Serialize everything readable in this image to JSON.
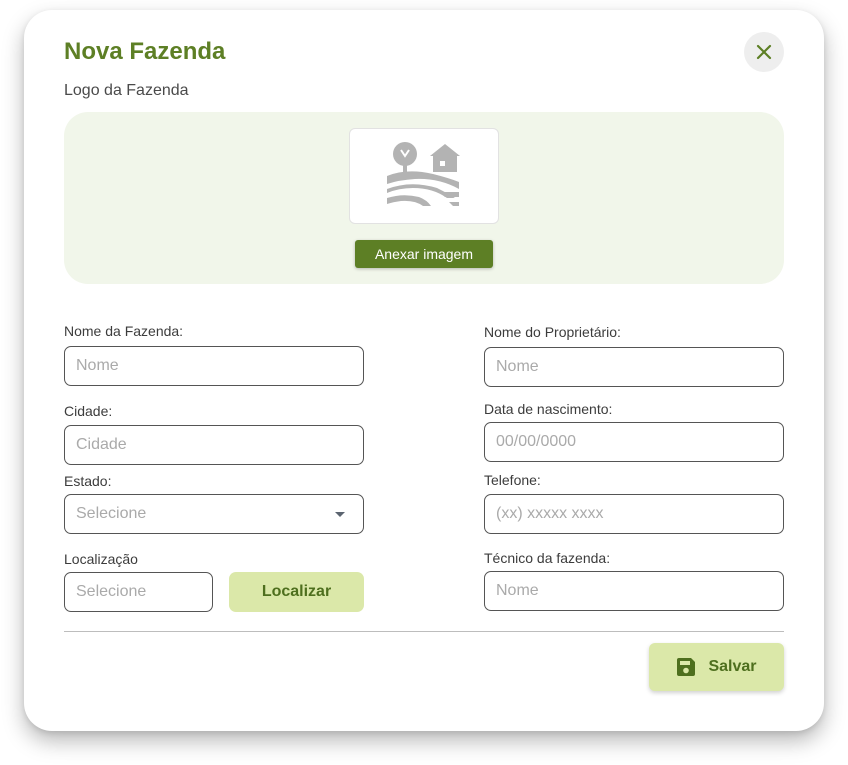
{
  "modal": {
    "title": "Nova Fazenda",
    "close_icon": "close-icon",
    "logo": {
      "label": "Logo da Fazenda",
      "preview_icon": "farm-landscape-icon",
      "attach_label": "Anexar imagem"
    }
  },
  "form": {
    "left": {
      "farm_name": {
        "label": "Nome da Fazenda:",
        "placeholder": "Nome",
        "value": ""
      },
      "city": {
        "label": "Cidade:",
        "placeholder": "Cidade",
        "value": ""
      },
      "state": {
        "label": "Estado:",
        "selected": "Selecione",
        "icon": "caret-down-icon"
      },
      "location": {
        "label": "Localização",
        "placeholder": "Selecione",
        "value": "",
        "button_label": "Localizar"
      }
    },
    "right": {
      "owner_name": {
        "label": "Nome do Proprietário:",
        "placeholder": "Nome",
        "value": ""
      },
      "birth_date": {
        "label": "Data de nascimento:",
        "placeholder": "00/00/0000",
        "value": ""
      },
      "phone": {
        "label": "Telefone:",
        "placeholder": "(xx) xxxxx xxxx",
        "value": ""
      },
      "technician": {
        "label": "Técnico da fazenda:",
        "placeholder": "Nome",
        "value": ""
      }
    }
  },
  "footer": {
    "save_label": "Salvar",
    "save_icon": "floppy-disk-icon"
  },
  "colors": {
    "primary_green": "#5d7f25",
    "light_green_button": "#dbe8a9",
    "upload_bg": "#f1f6ea",
    "input_border": "#555555",
    "placeholder": "#aaaaaa"
  }
}
